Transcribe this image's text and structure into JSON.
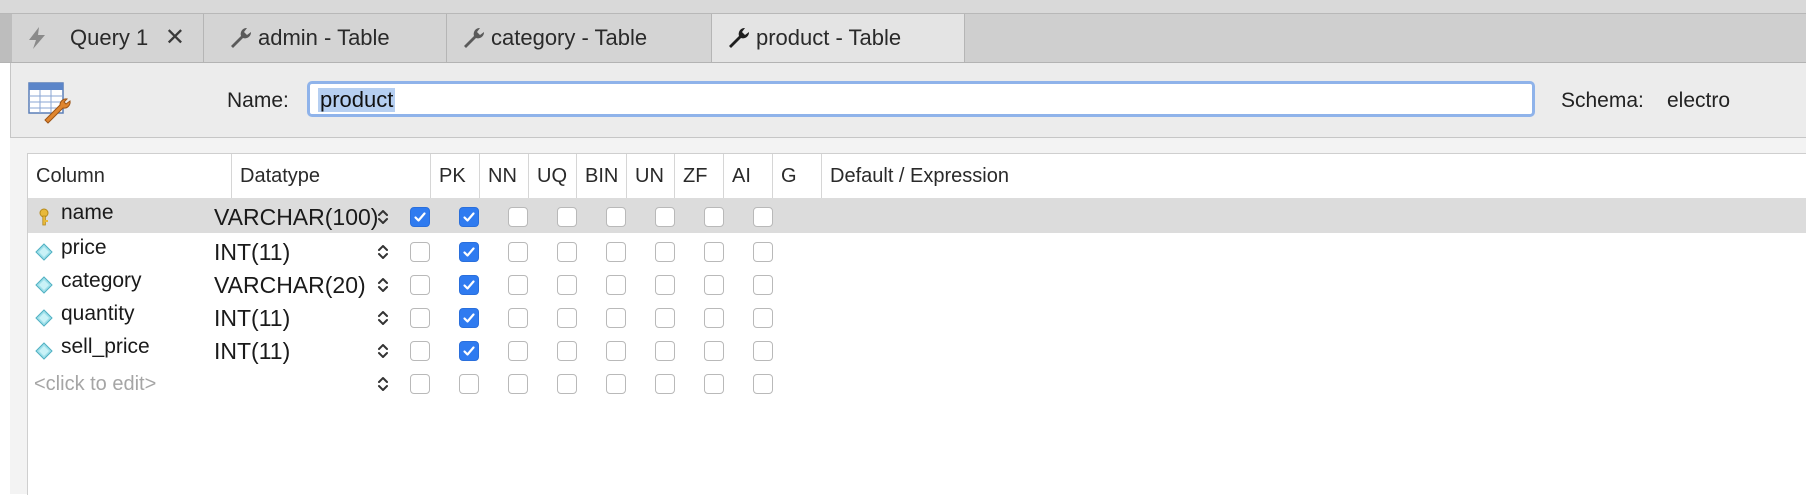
{
  "tabs": [
    {
      "label": "Query 1",
      "icon": "lightning-icon",
      "closable": true,
      "active": false
    },
    {
      "label": "admin - Table",
      "icon": "wrench-icon",
      "active": false
    },
    {
      "label": "category - Table",
      "icon": "wrench-icon",
      "active": false
    },
    {
      "label": "product - Table",
      "icon": "wrench-icon",
      "active": true
    }
  ],
  "name_row": {
    "name_label": "Name:",
    "name_value": "product",
    "schema_label": "Schema:",
    "schema_value": "electro"
  },
  "grid": {
    "headers": [
      "Column",
      "Datatype",
      "PK",
      "NN",
      "UQ",
      "BIN",
      "UN",
      "ZF",
      "AI",
      "G",
      "Default / Expression"
    ],
    "flag_keys": [
      "PK",
      "NN",
      "UQ",
      "BIN",
      "UN",
      "ZF",
      "AI",
      "G"
    ],
    "rows": [
      {
        "name": "name",
        "datatype": "VARCHAR(100)",
        "icon": "key-icon",
        "selected": true,
        "flags": {
          "PK": true,
          "NN": true,
          "UQ": false,
          "BIN": false,
          "UN": false,
          "ZF": false,
          "AI": false,
          "G": false
        }
      },
      {
        "name": "price",
        "datatype": "INT(11)",
        "icon": "diamond-icon",
        "selected": false,
        "flags": {
          "PK": false,
          "NN": true,
          "UQ": false,
          "BIN": false,
          "UN": false,
          "ZF": false,
          "AI": false,
          "G": false
        }
      },
      {
        "name": "category",
        "datatype": "VARCHAR(20)",
        "icon": "diamond-icon",
        "selected": false,
        "flags": {
          "PK": false,
          "NN": true,
          "UQ": false,
          "BIN": false,
          "UN": false,
          "ZF": false,
          "AI": false,
          "G": false
        }
      },
      {
        "name": "quantity",
        "datatype": "INT(11)",
        "icon": "diamond-icon",
        "selected": false,
        "flags": {
          "PK": false,
          "NN": true,
          "UQ": false,
          "BIN": false,
          "UN": false,
          "ZF": false,
          "AI": false,
          "G": false
        }
      },
      {
        "name": "sell_price",
        "datatype": "INT(11)",
        "icon": "diamond-icon",
        "selected": false,
        "flags": {
          "PK": false,
          "NN": true,
          "UQ": false,
          "BIN": false,
          "UN": false,
          "ZF": false,
          "AI": false,
          "G": false
        }
      }
    ],
    "new_row_placeholder": "<click to edit>"
  },
  "colors": {
    "accent": "#2f7bf0",
    "selection": "#b6cff1",
    "focus_ring": "#8fb3ea",
    "selected_row": "#dcdcdc"
  }
}
